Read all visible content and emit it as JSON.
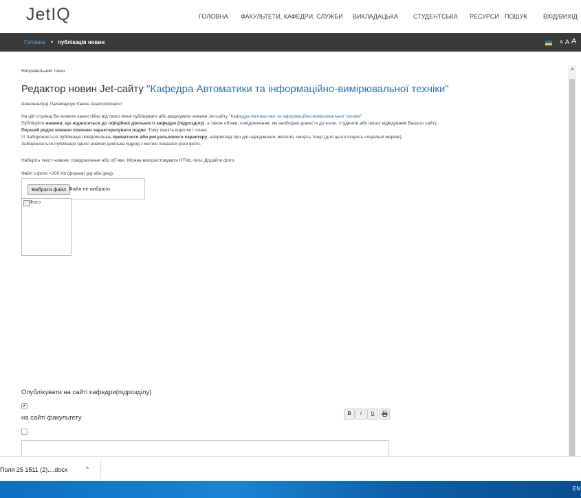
{
  "nav": {
    "logo": "JetIQ",
    "items": [
      "ГОЛОВНА",
      "ФАКУЛЬТЕТИ, КАФЕДРИ, СЛУЖБИ",
      "ВИКЛАДАЦЬКА",
      "СТУДЕНТСЬКА",
      "РЕСУРСИ",
      "ПОШУК",
      "ВХІД/ВИХІД"
    ]
  },
  "breadcrumb": {
    "home": "Головна",
    "separator": "•",
    "current": "публікація новин",
    "font_sizes": [
      "A",
      "A",
      "A"
    ]
  },
  "content": {
    "error": "Неправильний токен",
    "title_prefix": "Редактор новин Jet-сайту ",
    "title_department": "\"Кафедра Автоматики та інформаційно-вимірювальної техніки\"",
    "greeting": "Шановний(а) Паламарчук Євген Анатолійович!",
    "line1_a": "На цій сторінці Ви можете самостійно від свого імені публікувати або редагувати новини Jet-сайту ",
    "line1_link": "\"Кафедра Автоматики та інформаційно-вимірювальної техніки\"",
    "line2_a": "Публікуйте ",
    "line2_b": "новини, що відносяться до офіційної діяльності кафедри (підрозділу)",
    "line2_c": ", а також об'яви, повідомлення, які необхідно донести до колег, студентів або інших відвідувачів Вашого сайту.",
    "line3_a": "Перший рядок новини повинен характеризувати подію",
    "line3_b": ". Тому пишіть коротко і точно.",
    "line4_excl": "!!!",
    "line4_a": " Забороняється публікація повідомленнь ",
    "line4_b": "приватного або ритуальноного характеру",
    "line4_c": ", наприклад про дні народження, весілля, смерть тощо (для цього існують соціальні мережі).",
    "line5": "Забороняється публікація однієї новини декілька підряд з метою показати різні фото.",
    "instruction": "Наберіть текст новини, повідомлення або об`яви. Можна використовувати HTML-теги. Додайте фото.",
    "file_label": "Файл з фото <200 Kb (формат jpg або jpeg):",
    "file_button": "Вибрати файл",
    "file_status": "Файл не вибрано",
    "photo_alt": "Фото",
    "publish_department": "Опублікувати на сайті кафедри(підрозділу)",
    "publish_department_checked": true,
    "publish_faculty": "на сайті факультету",
    "publish_faculty_checked": false,
    "toolbar": {
      "bold": "B",
      "italic": "I",
      "underline": "U",
      "print_icon": "print-icon"
    }
  },
  "downloads": {
    "file": "Поля 25 1511 (2)....docx",
    "chevron": "^"
  },
  "taskbar": {
    "lang": "EN"
  },
  "colors": {
    "breadcrumb_bg": "#3a3a3a",
    "link_blue": "#2e72b8",
    "warning_red": "#dd0000",
    "taskbar_blue": "#1a84d4"
  }
}
